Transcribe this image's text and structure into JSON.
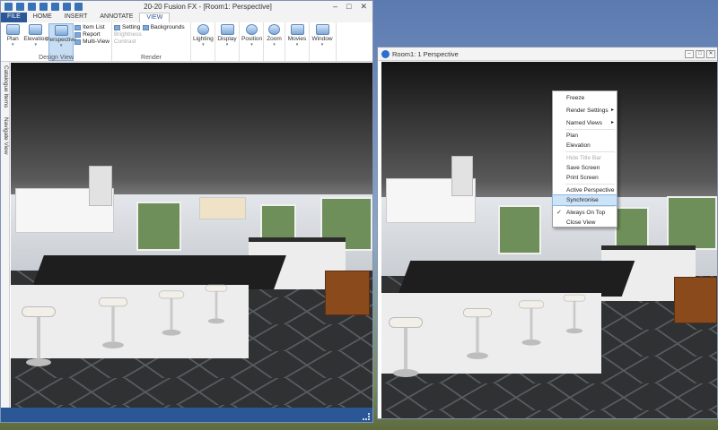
{
  "app": {
    "title": "20-20 Fusion FX - [Room1: Perspective]",
    "window_controls": [
      "–",
      "□",
      "✕"
    ],
    "tabs": [
      {
        "label": "FILE"
      },
      {
        "label": "HOME"
      },
      {
        "label": "INSERT"
      },
      {
        "label": "ANNOTATE"
      },
      {
        "label": "VIEW",
        "active": true
      }
    ],
    "ribbon": {
      "design_view": {
        "label": "Design View",
        "plan": "Plan",
        "elevation": "Elevation",
        "perspective": "Perspective",
        "item_list": "Item List",
        "report": "Report",
        "multi_view": "Multi-View"
      },
      "render": {
        "label": "Render",
        "setting": "Setting",
        "backgrounds": "Backgrounds",
        "brightness": "Brightness",
        "contrast": "Contrast"
      },
      "lighting": "Lighting",
      "display": "Display",
      "position": "Position",
      "zoom": "Zoom",
      "movies": "Movies",
      "window": "Window"
    },
    "sidebar": {
      "catalogue": "Catalogue Items",
      "navigate": "Navigate View"
    },
    "statusbar_color": "#2b5797"
  },
  "view_window": {
    "title": "Room1: 1 Perspective",
    "controls": [
      "–",
      "□",
      "✕"
    ]
  },
  "context_menu": {
    "items": {
      "freeze": "Freeze",
      "render_settings": "Render Settings",
      "named_views": "Named Views",
      "plan": "Plan",
      "elevation": "Elevation",
      "hide_title_bar": "Hide Title Bar",
      "save_screen": "Save Screen",
      "print_screen": "Print Screen",
      "active_perspective": "Active Perspective",
      "synchronise": "Synchronise",
      "always_on_top": "Always On Top",
      "close_view": "Close View"
    },
    "submenu_arrow": "▸",
    "check": "✓",
    "highlight_color": "#cde3f8"
  }
}
